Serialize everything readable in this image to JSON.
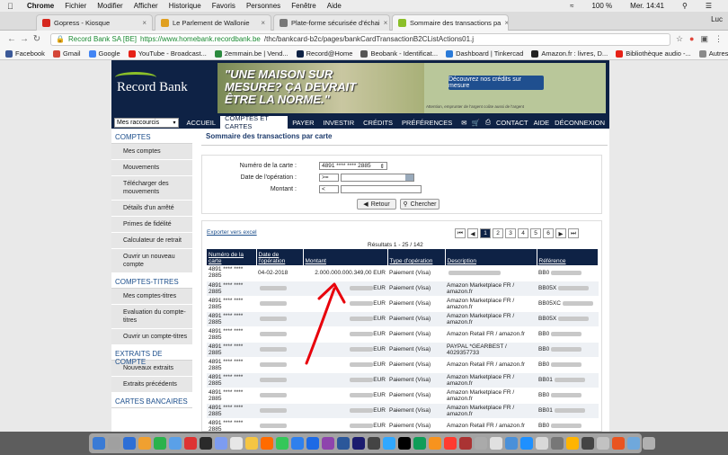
{
  "menubar": {
    "items": [
      "Chrome",
      "Fichier",
      "Modifier",
      "Afficher",
      "Historique",
      "Favoris",
      "Personnes",
      "Fenêtre",
      "Aide"
    ],
    "battery": "100 %",
    "clock": "Mer. 14:41"
  },
  "tabs": [
    {
      "title": "Gopress - Kiosque",
      "color": "#d6281f",
      "active": false
    },
    {
      "title": "Le Parlement de Wallonie",
      "color": "#e0a020",
      "active": false
    },
    {
      "title": "Plate-forme sécurisée d'échai",
      "color": "#777777",
      "active": false
    },
    {
      "title": "Sommaire des transactions pa",
      "color": "#8bbf29",
      "active": true
    }
  ],
  "user": "Luc",
  "address": {
    "secure": "Record Bank SA [BE]",
    "host": "https://www.homebank.recordbank.be",
    "path": "/thc/bankcard-b2c/pages/bankCardTransactionB2CListActions01.j"
  },
  "bookmarks": [
    {
      "label": "Facebook",
      "color": "#3b5998"
    },
    {
      "label": "Gmail",
      "color": "#d44638"
    },
    {
      "label": "Google",
      "color": "#4285f4"
    },
    {
      "label": "YouTube - Broadcast...",
      "color": "#e62117"
    },
    {
      "label": "2emmain.be | Vend...",
      "color": "#2b8a3e"
    },
    {
      "label": "Record@Home",
      "color": "#0e2245"
    },
    {
      "label": "Beobank - Identificat...",
      "color": "#555"
    },
    {
      "label": "Dashboard | Tinkercad",
      "color": "#2a7ad8"
    },
    {
      "label": "Amazon.fr : livres, D...",
      "color": "#222"
    },
    {
      "label": "Bibliothèque audio -...",
      "color": "#e62117"
    }
  ],
  "bookmarks_other": "Autres favoris",
  "brand": {
    "name": "Record Bank"
  },
  "banner": {
    "headline_line1": "\"UNE MAISON SUR",
    "headline_line2": "MESURE? ÇA DEVRAIT",
    "headline_line3": "ÊTRE LA NORME.\"",
    "cta": "Découvrez nos crédits sur mesure",
    "small": "Attention, emprunter de l'argent coûte aussi de l'argent"
  },
  "menu": {
    "shortcut": "Mes raccourcis",
    "items": [
      "ACCUEIL",
      "COMPTES ET CARTES",
      "PAYER",
      "INVESTIR",
      "CRÉDITS",
      "PRÉFÉRENCES"
    ],
    "active": "COMPTES ET CARTES",
    "tools": [
      "CONTACT",
      "AIDE",
      "DÉCONNEXION"
    ]
  },
  "sidebar": [
    {
      "type": "hd",
      "label": "COMPTES"
    },
    {
      "type": "it",
      "label": "Mes comptes"
    },
    {
      "type": "it",
      "label": "Mouvements"
    },
    {
      "type": "it",
      "label": "Télécharger des mouvements"
    },
    {
      "type": "it",
      "label": "Détails d'un arrêté"
    },
    {
      "type": "it",
      "label": "Primes de fidélité"
    },
    {
      "type": "it",
      "label": "Calculateur de retrait"
    },
    {
      "type": "it",
      "label": "Ouvrir un nouveau compte"
    },
    {
      "type": "hd",
      "label": "COMPTES-TITRES"
    },
    {
      "type": "it",
      "label": "Mes comptes-titres"
    },
    {
      "type": "it",
      "label": "Evaluation du compte-titres"
    },
    {
      "type": "it",
      "label": "Ouvrir un compte-titres"
    },
    {
      "type": "hd",
      "label": "EXTRAITS DE COMPTE"
    },
    {
      "type": "it",
      "label": "Nouveaux extraits"
    },
    {
      "type": "it",
      "label": "Extraits précédents"
    },
    {
      "type": "hd",
      "label": "CARTES BANCAIRES"
    }
  ],
  "content": {
    "title": "Sommaire des transactions par carte",
    "filters": {
      "card_label": "Numéro de la carte :",
      "card_value": "4891 **** **** 2885",
      "date_label": "Date de l'opération :",
      "date_op": ">=",
      "amount_label": "Montant :",
      "amount_op": "<",
      "back": "Retour",
      "search": "Chercher"
    },
    "export": "Exporter vers excel",
    "results_text": "Résultats 1 - 25 / 142",
    "pages": [
      "1",
      "2",
      "3",
      "4",
      "5",
      "6"
    ],
    "current_page": "1",
    "columns": [
      "Numéro de la carte",
      "Date de l'opération",
      "Montant",
      "Type d'opération",
      "Description",
      "Référence"
    ],
    "rows": [
      {
        "card": "4891 **** **** 2885",
        "date": "04-02-2018",
        "amount": "2.000.000.000.349,00 EUR",
        "type": "Paiement (Visa)",
        "desc": "",
        "ref": "BB0"
      },
      {
        "card": "4891 **** **** 2885",
        "date": "",
        "amount": "EUR",
        "type": "Paiement (Visa)",
        "desc": "Amazon Marketplace FR / amazon.fr",
        "ref": "BB05X"
      },
      {
        "card": "4891 **** **** 2885",
        "date": "",
        "amount": "EUR",
        "type": "Paiement (Visa)",
        "desc": "Amazon Marketplace FR / amazon.fr",
        "ref": "BB05XC"
      },
      {
        "card": "4891 **** **** 2885",
        "date": "",
        "amount": "EUR",
        "type": "Paiement (Visa)",
        "desc": "Amazon Marketplace FR / amazon.fr",
        "ref": "BB05X"
      },
      {
        "card": "4891 **** **** 2885",
        "date": "",
        "amount": "EUR",
        "type": "Paiement (Visa)",
        "desc": "Amazon Retail FR / amazon.fr",
        "ref": "BB0"
      },
      {
        "card": "4891 **** **** 2885",
        "date": "",
        "amount": "EUR",
        "type": "Paiement (Visa)",
        "desc": "PAYPAL *GEARBEST / 4029357733",
        "ref": "BB0"
      },
      {
        "card": "4891 **** **** 2885",
        "date": "",
        "amount": "EUR",
        "type": "Paiement (Visa)",
        "desc": "Amazon Retail FR / amazon.fr",
        "ref": "BB0"
      },
      {
        "card": "4891 **** **** 2885",
        "date": "",
        "amount": "EUR",
        "type": "Paiement (Visa)",
        "desc": "Amazon Marketplace FR / amazon.fr",
        "ref": "BB01"
      },
      {
        "card": "4891 **** **** 2885",
        "date": "",
        "amount": "EUR",
        "type": "Paiement (Visa)",
        "desc": "Amazon Marketplace FR / amazon.fr",
        "ref": "BB0"
      },
      {
        "card": "4891 **** **** 2885",
        "date": "",
        "amount": "EUR",
        "type": "Paiement (Visa)",
        "desc": "Amazon Marketplace FR / amazon.fr",
        "ref": "BB01"
      },
      {
        "card": "4891 **** **** 2885",
        "date": "",
        "amount": "EUR",
        "type": "Paiement (Visa)",
        "desc": "Amazon Retail FR / amazon.fr",
        "ref": "BB0"
      }
    ]
  },
  "arrow_color": "#e8000b",
  "dock_colors": [
    "#3a7bd5",
    "#a0a0a0",
    "#2e6fd6",
    "#f0a030",
    "#2bb24c",
    "#5aa0e8",
    "#d33",
    "#2a2a2a",
    "#7d9cf0",
    "#e7e7e7",
    "#f5c542",
    "#ff6b00",
    "#34c759",
    "#2f80ed",
    "#1d6ae5",
    "#8e44ad",
    "#2b579a",
    "#1b1b6e",
    "#444",
    "#31a8ff",
    "#000",
    "#0f9d58",
    "#f7931e",
    "#ff3b30",
    "#a33",
    "#aaa",
    "#e0e0e0",
    "#4a90d9",
    "#1e90ff",
    "#d9d9d9",
    "#777",
    "#ffb400",
    "#444",
    "#c2c2c2",
    "#e95420",
    "#6fa8dc",
    "#b0b0b0"
  ]
}
